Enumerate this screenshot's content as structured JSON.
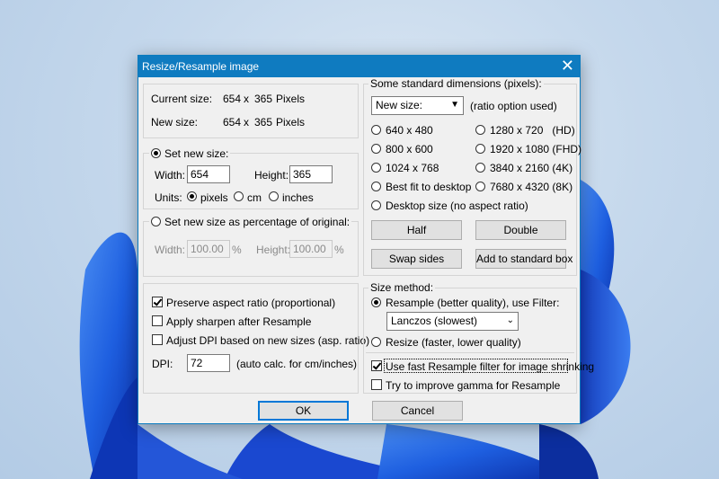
{
  "dialog": {
    "title": "Resize/Resample image",
    "close_glyph": "✕"
  },
  "sizes": {
    "current_label": "Current size:",
    "current_w": "654",
    "x1": "x",
    "current_h": "365",
    "current_unit": "Pixels",
    "new_label": "New size:",
    "new_w": "654",
    "x2": "x",
    "new_h": "365",
    "new_unit": "Pixels"
  },
  "set_new": {
    "radio_label": "Set new size:",
    "selected": true,
    "width_label": "Width:",
    "width_value": "654",
    "height_label": "Height:",
    "height_value": "365",
    "units_label": "Units:",
    "unit_pixels": "pixels",
    "unit_cm": "cm",
    "unit_inches": "inches",
    "selected_unit": "pixels"
  },
  "percent": {
    "radio_label": "Set new size as percentage of original:",
    "width_label": "Width:",
    "width_value": "100.00",
    "width_unit": "%",
    "height_label": "Height:",
    "height_value": "100.00",
    "height_unit": "%"
  },
  "options": {
    "preserve": "Preserve aspect ratio (proportional)",
    "preserve_checked": true,
    "sharpen": "Apply sharpen after Resample",
    "adjust_dpi": "Adjust DPI based on new sizes (asp. ratio)",
    "dpi_label": "DPI:",
    "dpi_value": "72",
    "dpi_note": "(auto calc. for cm/inches)"
  },
  "standard": {
    "title": "Some standard dimensions (pixels):",
    "select_value": "New size:",
    "select_note": "(ratio option used)",
    "r640": "640 x 480",
    "r800": "800 x 600",
    "r1024": "1024 x 768",
    "best_fit": "Best fit to desktop",
    "desktop": "Desktop size (no aspect ratio)",
    "r1280": "1280 x 720   (HD)",
    "r1920": "1920 x 1080 (FHD)",
    "r3840": "3840 x 2160 (4K)",
    "r7680": "7680 x 4320 (8K)",
    "half": "Half",
    "double": "Double",
    "swap": "Swap sides",
    "add_box": "Add to standard box"
  },
  "method": {
    "title": "Size method:",
    "resample": "Resample (better quality), use Filter:",
    "filter": "Lanczos (slowest)",
    "resize": "Resize (faster, lower quality)",
    "fast_resample": "Use fast Resample filter for image shrinking",
    "fast_checked": true,
    "gamma": "Try to improve gamma for Resample"
  },
  "footer": {
    "ok": "OK",
    "cancel": "Cancel"
  },
  "colors": {
    "titlebar": "#0f7bc0",
    "focus_border": "#0078d7"
  }
}
